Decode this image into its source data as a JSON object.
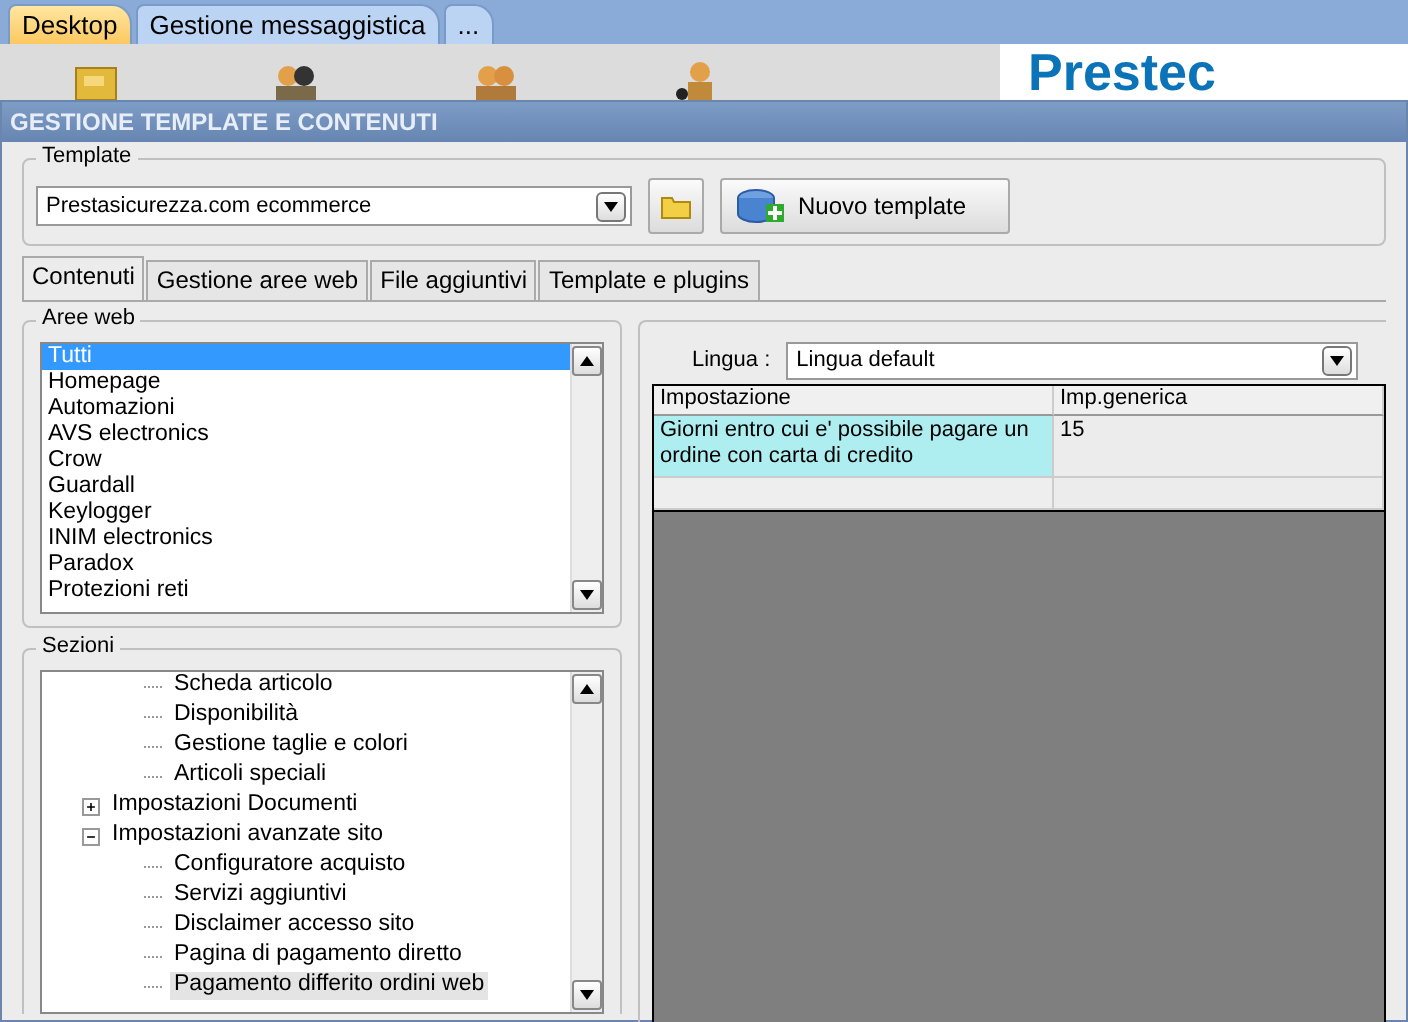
{
  "top_tabs": [
    {
      "label": "Desktop",
      "selected": true
    },
    {
      "label": "Gestione messaggistica",
      "selected": false
    },
    {
      "label": "...",
      "selected": false
    }
  ],
  "desktop": {
    "logo": "Prestec"
  },
  "window": {
    "title": "GESTIONE TEMPLATE E CONTENUTI"
  },
  "template": {
    "legend": "Template",
    "value": "Prestasicurezza.com ecommerce",
    "new_button": "Nuovo template"
  },
  "tabs": [
    {
      "label": "Contenuti",
      "selected": true
    },
    {
      "label": "Gestione aree web",
      "selected": false
    },
    {
      "label": "File aggiuntivi",
      "selected": false
    },
    {
      "label": "Template e plugins",
      "selected": false
    }
  ],
  "aree_web": {
    "legend": "Aree web",
    "items": [
      {
        "label": "Tutti",
        "selected": true
      },
      {
        "label": "Homepage",
        "selected": false
      },
      {
        "label": "Automazioni",
        "selected": false
      },
      {
        "label": "AVS electronics",
        "selected": false
      },
      {
        "label": "Crow",
        "selected": false
      },
      {
        "label": "Guardall",
        "selected": false
      },
      {
        "label": "Keylogger",
        "selected": false
      },
      {
        "label": "INIM electronics",
        "selected": false
      },
      {
        "label": "Paradox",
        "selected": false
      },
      {
        "label": "Protezioni reti",
        "selected": false
      }
    ]
  },
  "sezioni": {
    "legend": "Sezioni",
    "items": [
      {
        "label": "Scheda articolo",
        "selected": false
      },
      {
        "label": "Disponibilità",
        "selected": false
      },
      {
        "label": "Gestione taglie e colori",
        "selected": false
      },
      {
        "label": "Articoli speciali",
        "selected": false
      },
      {
        "label": "Impostazioni Documenti",
        "selected": false,
        "expanded": false
      },
      {
        "label": "Impostazioni avanzate sito",
        "selected": false,
        "expanded": true,
        "children": [
          {
            "label": "Configuratore acquisto",
            "selected": false
          },
          {
            "label": "Servizi aggiuntivi",
            "selected": false
          },
          {
            "label": "Disclaimer accesso sito",
            "selected": false
          },
          {
            "label": "Pagina di pagamento diretto",
            "selected": false
          },
          {
            "label": "Pagamento differito ordini web",
            "selected": true
          }
        ]
      }
    ]
  },
  "lingua": {
    "label": "Lingua :",
    "value": "Lingua default"
  },
  "table": {
    "columns": [
      "Impostazione",
      "Imp.generica"
    ],
    "rows": [
      [
        "Giorni entro cui e' possibile pagare un ordine con carta di credito",
        "15"
      ]
    ]
  }
}
